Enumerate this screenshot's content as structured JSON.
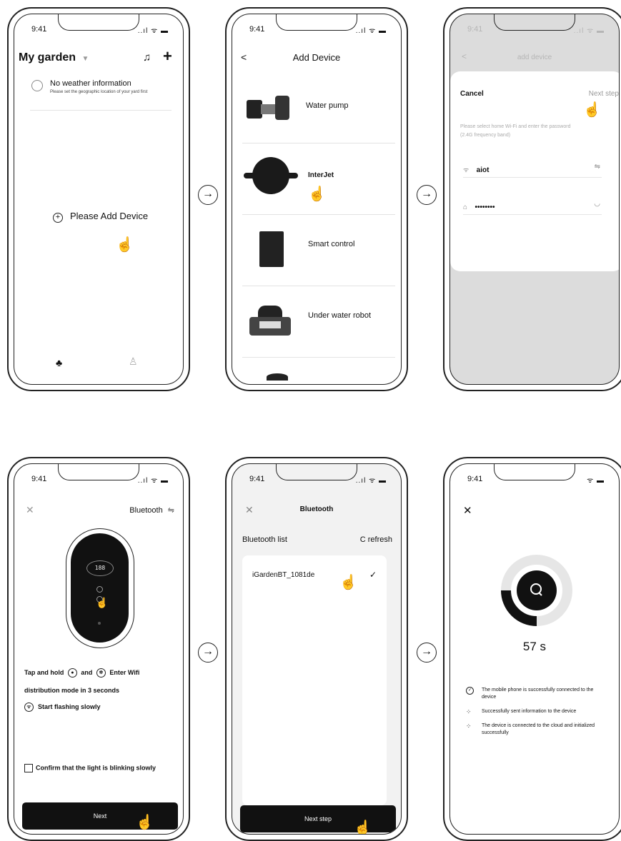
{
  "status": {
    "time": "9:41",
    "icons": "..ıl ᯤ ▬"
  },
  "common": {
    "arrow": "→",
    "hand": "☝"
  },
  "s1": {
    "title": "My garden",
    "weather_title": "No weather information",
    "weather_sub": "Please set the geographic location of your yard first",
    "add_label": "Please Add Device"
  },
  "s2": {
    "title": "Add Device",
    "devices": [
      {
        "label": "Water pump"
      },
      {
        "label": "InterJet"
      },
      {
        "label": "Smart control"
      },
      {
        "label": "Under water robot"
      }
    ]
  },
  "s3": {
    "title": "add device",
    "cancel": "Cancel",
    "next": "Next step",
    "hint": "Please select home Wi-Fi and enter the password (2.4G frequency band)",
    "wifi_value": "aiot",
    "password_value": "••••••••"
  },
  "s4": {
    "title": "Bluetooth",
    "display": "188",
    "instr_1a": "Tap and hold",
    "instr_1b": "and",
    "instr_1c": "Enter Wifi",
    "instr_2": "distribution mode in 3 seconds",
    "instr_3": "Start flashing slowly",
    "confirm": "Confirm that the light is blinking slowly",
    "button": "Next"
  },
  "s5": {
    "title": "Bluetooth",
    "list_label": "Bluetooth list",
    "refresh": "refresh",
    "device": "iGardenBT_1081de",
    "button": "Next step"
  },
  "s6": {
    "seconds": "57 s",
    "progress": 0.25,
    "steps": [
      {
        "text": "The mobile phone is successfully connected to the device",
        "icon": "check-circle-icon"
      },
      {
        "text": "Successfully sent information to the device",
        "icon": "spinner-icon"
      },
      {
        "text": "The device is connected to the cloud and initialized successfully",
        "icon": "spinner-icon"
      }
    ]
  }
}
